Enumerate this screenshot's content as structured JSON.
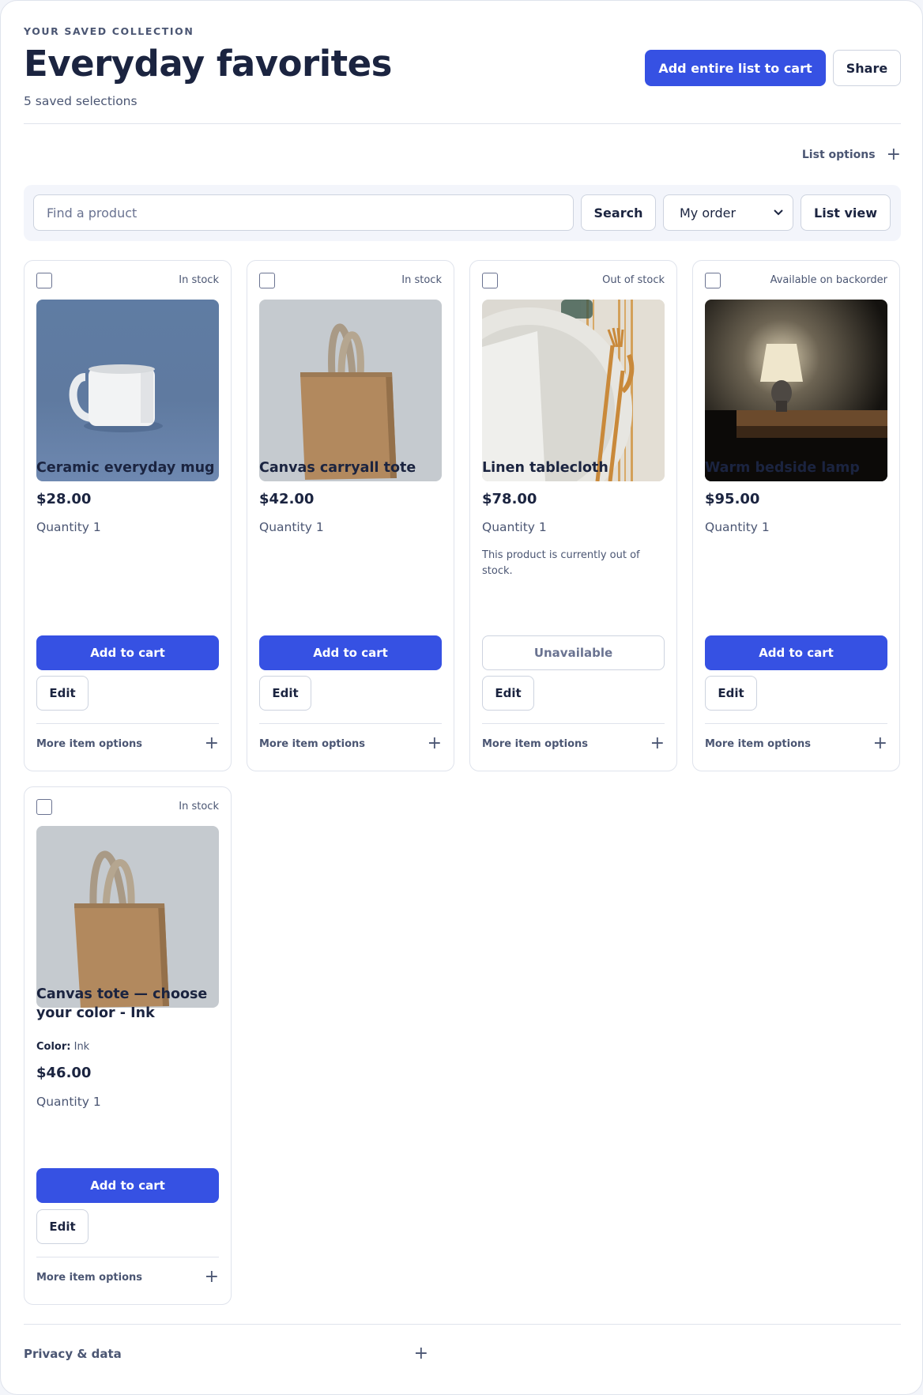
{
  "header": {
    "eyebrow": "YOUR SAVED COLLECTION",
    "title": "Everyday favorites",
    "subtitle": "5 saved selections",
    "add_all_label": "Add entire list to cart",
    "share_label": "Share"
  },
  "list_options": {
    "label": "List options",
    "icon": "plus-icon"
  },
  "toolbar": {
    "search_placeholder": "Find a product",
    "search_value": "",
    "search_button": "Search",
    "sort_selected": "My order",
    "view_button": "List view"
  },
  "colors": {
    "accent": "#3651e3",
    "text": "#1b2440",
    "muted": "#4b5673",
    "border": "#dfe3ec"
  },
  "items": [
    {
      "stock": "In stock",
      "name": "Ceramic everyday mug",
      "price": "$28.00",
      "quantity": "Quantity 1",
      "action": "Add to cart",
      "edit": "Edit",
      "more": "More item options",
      "image": "white-mug-photo"
    },
    {
      "stock": "In stock",
      "name": "Canvas carryall tote",
      "price": "$42.00",
      "quantity": "Quantity 1",
      "action": "Add to cart",
      "edit": "Edit",
      "more": "More item options",
      "image": "tan-tote-photo"
    },
    {
      "stock": "Out of stock",
      "name": "Linen tablecloth",
      "price": "$78.00",
      "quantity": "Quantity 1",
      "note": "This product is currently out of stock.",
      "action": "Unavailable",
      "edit": "Edit",
      "more": "More item options",
      "image": "table-setting-photo"
    },
    {
      "stock": "Available on backorder",
      "name": "Warm bedside lamp",
      "price": "$95.00",
      "quantity": "Quantity 1",
      "action": "Add to cart",
      "edit": "Edit",
      "more": "More item options",
      "image": "bedside-lamp-photo"
    },
    {
      "stock": "In stock",
      "name": "Canvas tote — choose your color - Ink",
      "color_label": "Color:",
      "color_value": "Ink",
      "price": "$46.00",
      "quantity": "Quantity 1",
      "action": "Add to cart",
      "edit": "Edit",
      "more": "More item options",
      "image": "tan-tote-photo"
    }
  ],
  "footer": {
    "privacy_label": "Privacy & data",
    "icon": "plus-icon"
  }
}
